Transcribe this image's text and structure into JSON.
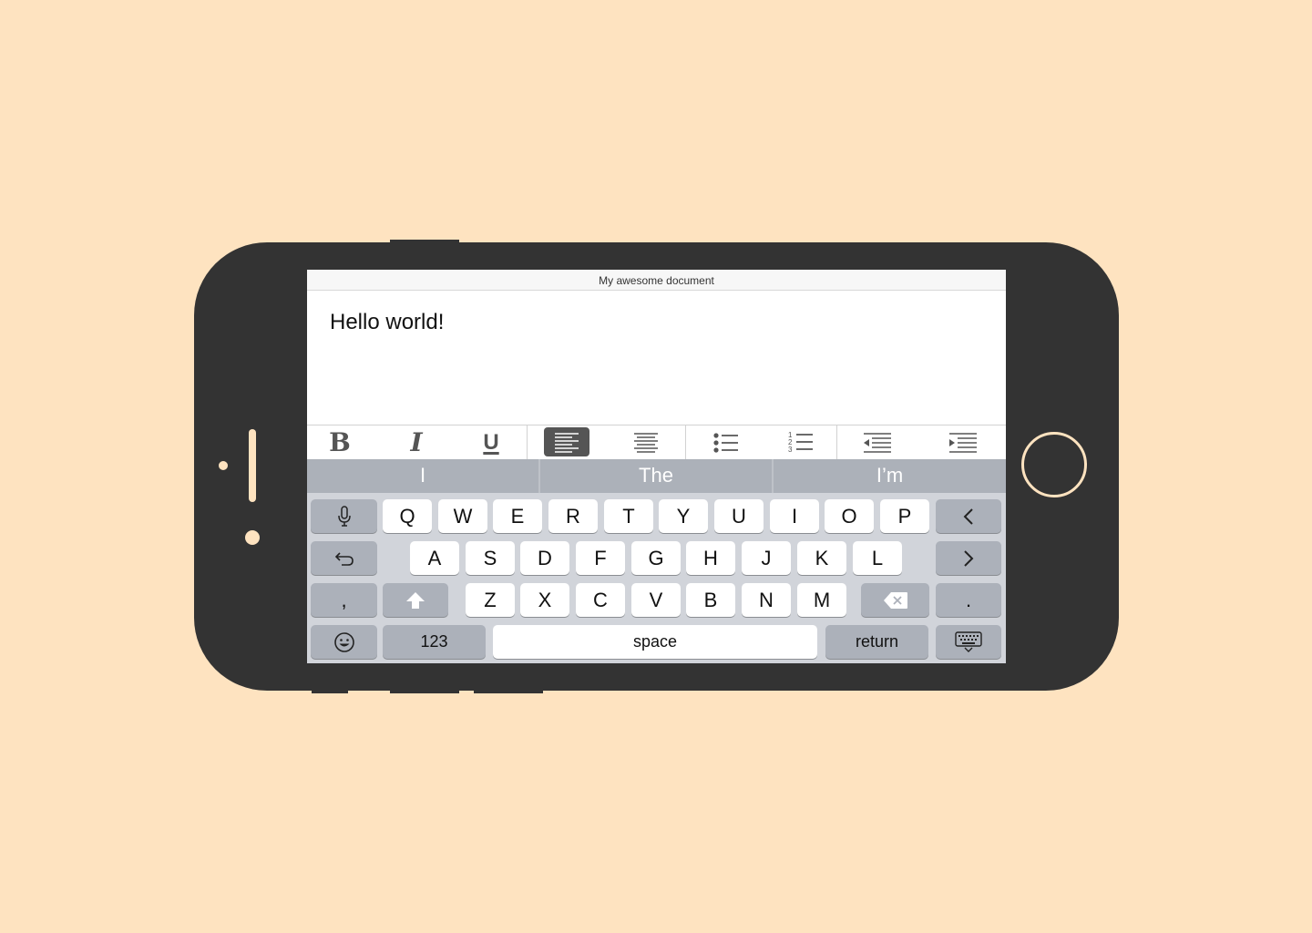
{
  "document": {
    "title": "My awesome document",
    "body": "Hello world!"
  },
  "toolbar": {
    "tools": [
      "bold",
      "italic",
      "underline",
      "align-left",
      "align-center",
      "bulleted-list",
      "numbered-list",
      "outdent",
      "indent"
    ],
    "active_tool": "align-left",
    "glyphs": {
      "bold": "B",
      "italic": "I",
      "underline": "U"
    }
  },
  "suggestions": [
    "I",
    "The",
    "I’m"
  ],
  "keyboard": {
    "row1": [
      "Q",
      "W",
      "E",
      "R",
      "T",
      "Y",
      "U",
      "I",
      "O",
      "P"
    ],
    "row2": [
      "A",
      "S",
      "D",
      "F",
      "G",
      "H",
      "J",
      "K",
      "L"
    ],
    "row3": [
      "Z",
      "X",
      "C",
      "V",
      "B",
      "N",
      "M"
    ],
    "comma": ",",
    "period": ".",
    "numbers_label": "123",
    "space_label": "space",
    "return_label": "return"
  },
  "colors": {
    "background": "#FEE3C0",
    "device": "#333333",
    "keyboard_bg": "#D1D4DA",
    "suggestion_bar": "#ACB1B9",
    "special_key": "#ACB1BA",
    "active_tool": "#555555"
  }
}
